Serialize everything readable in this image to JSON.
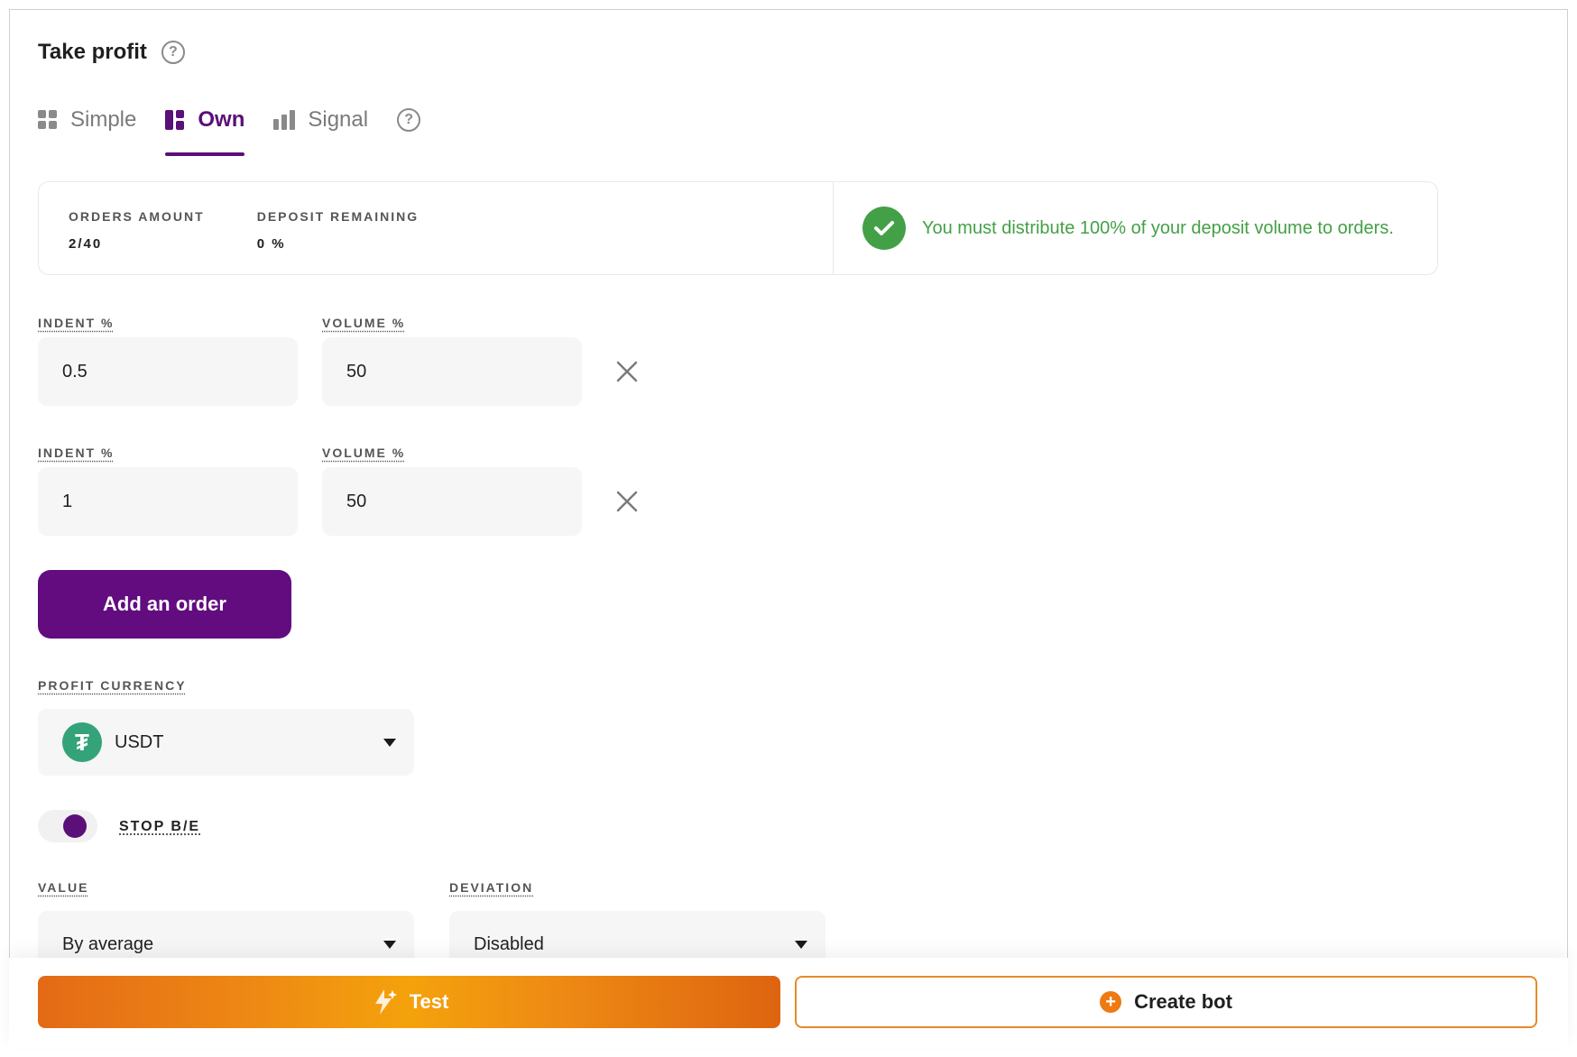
{
  "header": {
    "title": "Take profit"
  },
  "tabs": [
    {
      "label": "Simple",
      "icon": "grid-icon",
      "active": false
    },
    {
      "label": "Own",
      "icon": "layout-icon",
      "active": true
    },
    {
      "label": "Signal",
      "icon": "bar-chart-icon",
      "active": false
    }
  ],
  "summary": {
    "orders_label": "ORDERS AMOUNT",
    "orders_value": "2/40",
    "deposit_label": "DEPOSIT REMAINING",
    "deposit_value": "0 %",
    "message": "You must distribute 100% of your deposit volume to orders."
  },
  "orders": [
    {
      "indent_label": "INDENT %",
      "indent_value": "0.5",
      "volume_label": "VOLUME %",
      "volume_value": "50"
    },
    {
      "indent_label": "INDENT %",
      "indent_value": "1",
      "volume_label": "VOLUME %",
      "volume_value": "50"
    }
  ],
  "add_order_label": "Add an order",
  "profit_currency": {
    "label": "PROFIT CURRENCY",
    "value": "USDT",
    "icon_text": "₮"
  },
  "stop_be": {
    "label": "STOP B/E",
    "enabled": true
  },
  "value": {
    "label": "VALUE",
    "selected": "By average"
  },
  "deviation": {
    "label": "DEVIATION",
    "selected": "Disabled"
  },
  "footer": {
    "test_label": "Test",
    "create_label": "Create bot"
  },
  "colors": {
    "brand": "#5b0f78",
    "success": "#43a047",
    "accent": "#ee7a12"
  }
}
